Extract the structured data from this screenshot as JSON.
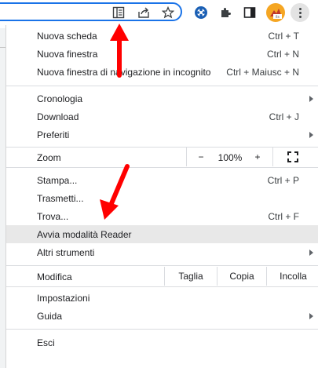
{
  "menu": {
    "items": [
      {
        "label": "Nuova scheda",
        "shortcut": "Ctrl + T"
      },
      {
        "label": "Nuova finestra",
        "shortcut": "Ctrl + N"
      },
      {
        "label": "Nuova finestra di navigazione in incognito",
        "shortcut": "Ctrl + Maiusc + N"
      },
      {
        "label": "Cronologia"
      },
      {
        "label": "Download",
        "shortcut": "Ctrl + J"
      },
      {
        "label": "Preferiti"
      },
      {
        "label": "Stampa...",
        "shortcut": "Ctrl + P"
      },
      {
        "label": "Trasmetti..."
      },
      {
        "label": "Trova...",
        "shortcut": "Ctrl + F"
      },
      {
        "label": "Avvia modalità Reader"
      },
      {
        "label": "Altri strumenti"
      },
      {
        "label": "Impostazioni"
      },
      {
        "label": "Guida"
      },
      {
        "label": "Esci"
      }
    ],
    "zoom": {
      "label": "Zoom",
      "minus": "−",
      "value": "100%",
      "plus": "+"
    },
    "edit": {
      "label": "Modifica",
      "cut": "Taglia",
      "copy": "Copia",
      "paste": "Incolla"
    }
  },
  "icons": {
    "reader_mode": "reader-mode-icon",
    "share": "share-icon",
    "bookmark": "star-icon",
    "extension_1": "extension-icon",
    "extensions": "puzzle-icon",
    "side_panel": "side-panel-icon",
    "profile": "avatar",
    "menu": "three-dots-icon"
  },
  "colors": {
    "accent": "#1a73e8",
    "annotation_arrow": "#ff0000",
    "highlight": "#e8e8e8"
  }
}
